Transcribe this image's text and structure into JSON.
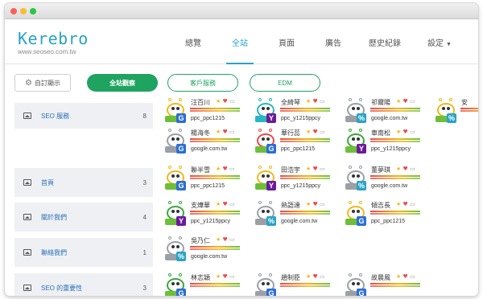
{
  "brand": {
    "name": "Kerebro",
    "url": "www.seoseo.com.tw"
  },
  "nav": [
    {
      "label": "總覽"
    },
    {
      "label": "全站"
    },
    {
      "label": "頁面"
    },
    {
      "label": "廣告"
    },
    {
      "label": "歷史紀錄"
    },
    {
      "label": "設定"
    }
  ],
  "toolbar": {
    "custom_label": "自訂顯示",
    "all_label": "全站觀察",
    "cs_label": "客戶服務",
    "edm_label": "EDM"
  },
  "pages": [
    {
      "label": "SEO 服務",
      "count": "8"
    },
    {
      "label": "首頁",
      "count": "3"
    },
    {
      "label": "關於我們",
      "count": "4"
    },
    {
      "label": "聯絡我們",
      "count": "1"
    },
    {
      "label": "SEO 的重要性",
      "count": "3"
    }
  ],
  "visitors": [
    {
      "name": "汪百川",
      "source": "ppc_ppc1215",
      "badge": "G",
      "color": "yellow"
    },
    {
      "name": "全綺琴",
      "source": "ppc_y1215ppcy",
      "badge": "Y",
      "color": "cyan"
    },
    {
      "name": "祁爾陽",
      "source": "google.com.tw",
      "badge": "%",
      "color": "gray"
    },
    {
      "name": "安",
      "source": "",
      "badge": "%",
      "color": "yellow"
    },
    {
      "name": "楊海冬",
      "source": "google.com.tw",
      "badge": "G",
      "color": "gray"
    },
    {
      "name": "華行蕊",
      "source": "ppc_ppc1215",
      "badge": "G",
      "color": "red"
    },
    {
      "name": "車南松",
      "source": "ppc_y1215ppcy",
      "badge": "Y",
      "color": "green"
    },
    {
      "name": "聯半雪",
      "source": "ppc_ppc1215",
      "badge": "G",
      "color": "yellow"
    },
    {
      "name": "田浩宇",
      "source": "ppc_y1215ppcy",
      "badge": "Y",
      "color": "yellow"
    },
    {
      "name": "董夢琪",
      "source": "google.com.tw",
      "badge": "%",
      "color": "gray"
    },
    {
      "name": "支燁華",
      "source": "ppc_y1215ppcy",
      "badge": "Y",
      "color": "green"
    },
    {
      "name": "熱語達",
      "source": "google.com.tw",
      "badge": "%",
      "color": "gray"
    },
    {
      "name": "傾吉長",
      "source": "ppc_ppc1215",
      "badge": "G",
      "color": "yellow"
    },
    {
      "name": "吳乃仁",
      "source": "google.com.tw",
      "badge": "%",
      "color": "gray"
    },
    {
      "name": "林志穎",
      "source": "",
      "badge": "G",
      "color": "green"
    },
    {
      "name": "趙制臣",
      "source": "",
      "badge": "G",
      "color": "gray"
    },
    {
      "name": "故晨風",
      "source": "",
      "badge": "G",
      "color": "gray"
    }
  ],
  "icons": {
    "settings": "gear-icon",
    "page": "image-icon",
    "star": "star-icon",
    "heart": "heart-icon",
    "device": "desktop-icon"
  },
  "colors": {
    "accent": "#29a3c4",
    "primary_green": "#1ea360"
  }
}
